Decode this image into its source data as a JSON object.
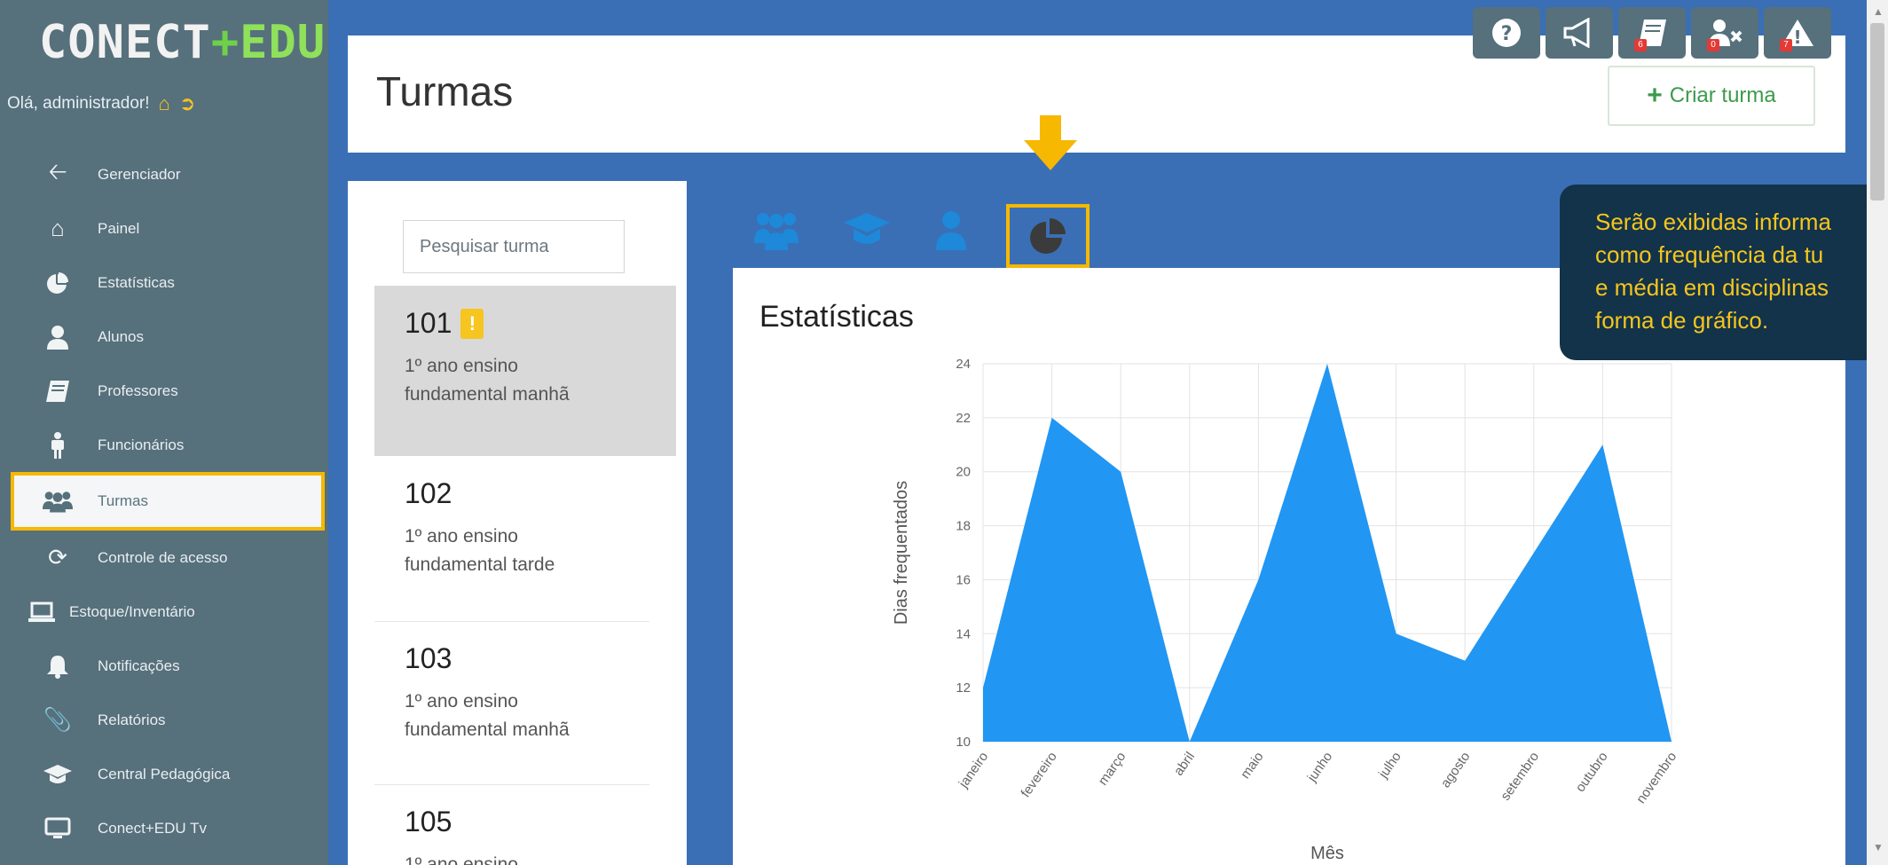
{
  "app": {
    "logo_main": "CONECT",
    "logo_plus": "+",
    "logo_edu": "EDU",
    "greeting": "Olá, administrador!"
  },
  "sidebar": {
    "items": [
      {
        "label": "Gerenciador",
        "icon": "arrow-left-icon"
      },
      {
        "label": "Painel",
        "icon": "home-icon"
      },
      {
        "label": "Estatísticas",
        "icon": "pie-chart-icon"
      },
      {
        "label": "Alunos",
        "icon": "user-icon"
      },
      {
        "label": "Professores",
        "icon": "book-icon"
      },
      {
        "label": "Funcionários",
        "icon": "person-icon"
      },
      {
        "label": "Turmas",
        "icon": "users-icon",
        "active": true
      },
      {
        "label": "Controle de acesso",
        "icon": "refresh-icon"
      },
      {
        "label": "Estoque/Inventário",
        "icon": "laptop-icon"
      },
      {
        "label": "Notificações",
        "icon": "bell-icon"
      },
      {
        "label": "Relatórios",
        "icon": "paperclip-icon"
      },
      {
        "label": "Central Pedagógica",
        "icon": "graduation-cap-icon"
      },
      {
        "label": "Conect+EDU Tv",
        "icon": "monitor-icon"
      }
    ]
  },
  "topbar": {
    "badges": [
      "6",
      "0",
      "7"
    ]
  },
  "header": {
    "title": "Turmas",
    "create_button": "Criar turma"
  },
  "list": {
    "search_placeholder": "Pesquisar turma",
    "classes": [
      {
        "num": "101",
        "warn": "!",
        "desc": "1º ano ensino fundamental manhã",
        "selected": true
      },
      {
        "num": "102",
        "desc": "1º ano ensino fundamental tarde"
      },
      {
        "num": "103",
        "desc": "1º ano ensino fundamental manhã"
      },
      {
        "num": "105",
        "desc": "1º ano ensino"
      }
    ]
  },
  "callout": {
    "lines": [
      "Serão exibidas informa",
      "como frequência da tu",
      "e média em disciplinas",
      "forma de gráfico."
    ]
  },
  "colors": {
    "sidebar": "#56707c",
    "accent": "#f6b800",
    "chart_fill": "#2196f3",
    "callout_bg": "#123349",
    "callout_text": "#f6c51f"
  },
  "chart_data": {
    "type": "area",
    "title": "Estatísticas",
    "xlabel": "Mês",
    "ylabel": "Dias frequentados",
    "categories": [
      "janeiro",
      "fevereiro",
      "março",
      "abril",
      "maio",
      "junho",
      "julho",
      "agosto",
      "setembro",
      "outubro",
      "novembro"
    ],
    "values": [
      12,
      22,
      20,
      10,
      16,
      24,
      14,
      13,
      17,
      21,
      10
    ],
    "ylim": [
      10,
      24
    ],
    "yticks": [
      10,
      12,
      14,
      16,
      18,
      20,
      22,
      24
    ],
    "grid": true
  }
}
